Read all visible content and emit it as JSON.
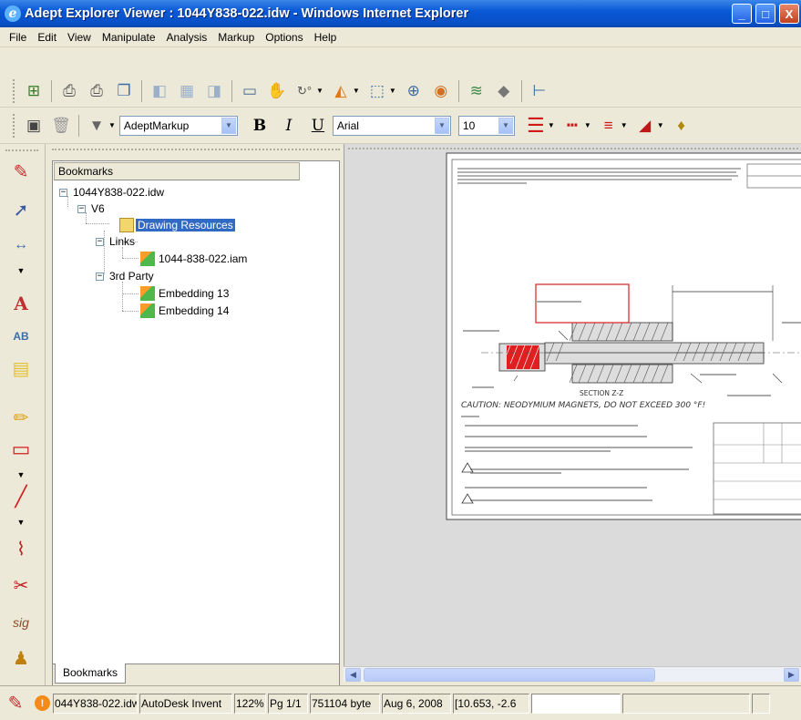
{
  "window": {
    "title": "Adept Explorer Viewer : 1044Y838-022.idw - Windows Internet Explorer",
    "minimize_label": "_",
    "maximize_label": "□",
    "close_label": "X"
  },
  "menu": [
    "File",
    "Edit",
    "View",
    "Manipulate",
    "Analysis",
    "Markup",
    "Options",
    "Help"
  ],
  "toolbar2": {
    "markup_layer": "AdeptMarkup",
    "bold_label": "B",
    "italic_label": "I",
    "underline_label": "U",
    "font": "Arial",
    "font_size": "10"
  },
  "bookmarks": {
    "header": "Bookmarks",
    "tab_label": "Bookmarks",
    "tree": {
      "root": "1044Y838-022.idw",
      "v6": "V6",
      "drawing_resources": "Drawing Resources",
      "links": "Links",
      "link_iam": "1044-838-022.iam",
      "third_party": "3rd Party",
      "embedding13": "Embedding 13",
      "embedding14": "Embedding 14"
    }
  },
  "drawing": {
    "section_label": "SECTION Z-Z",
    "caution": "CAUTION: NEODYMIUM MAGNETS, DO NOT EXCEED 300 °F!"
  },
  "status": {
    "file": "044Y838-022.idw",
    "application": "AutoDesk Invent",
    "zoom": "122%",
    "page": "Pg 1/1",
    "size": "751104 byte",
    "date": "Aug 6, 2008",
    "coords": "[10.653, -2.6"
  },
  "colors": {
    "title_bar": "#0a58d6",
    "selection": "#316ac5",
    "markup_red": "#e02020"
  }
}
